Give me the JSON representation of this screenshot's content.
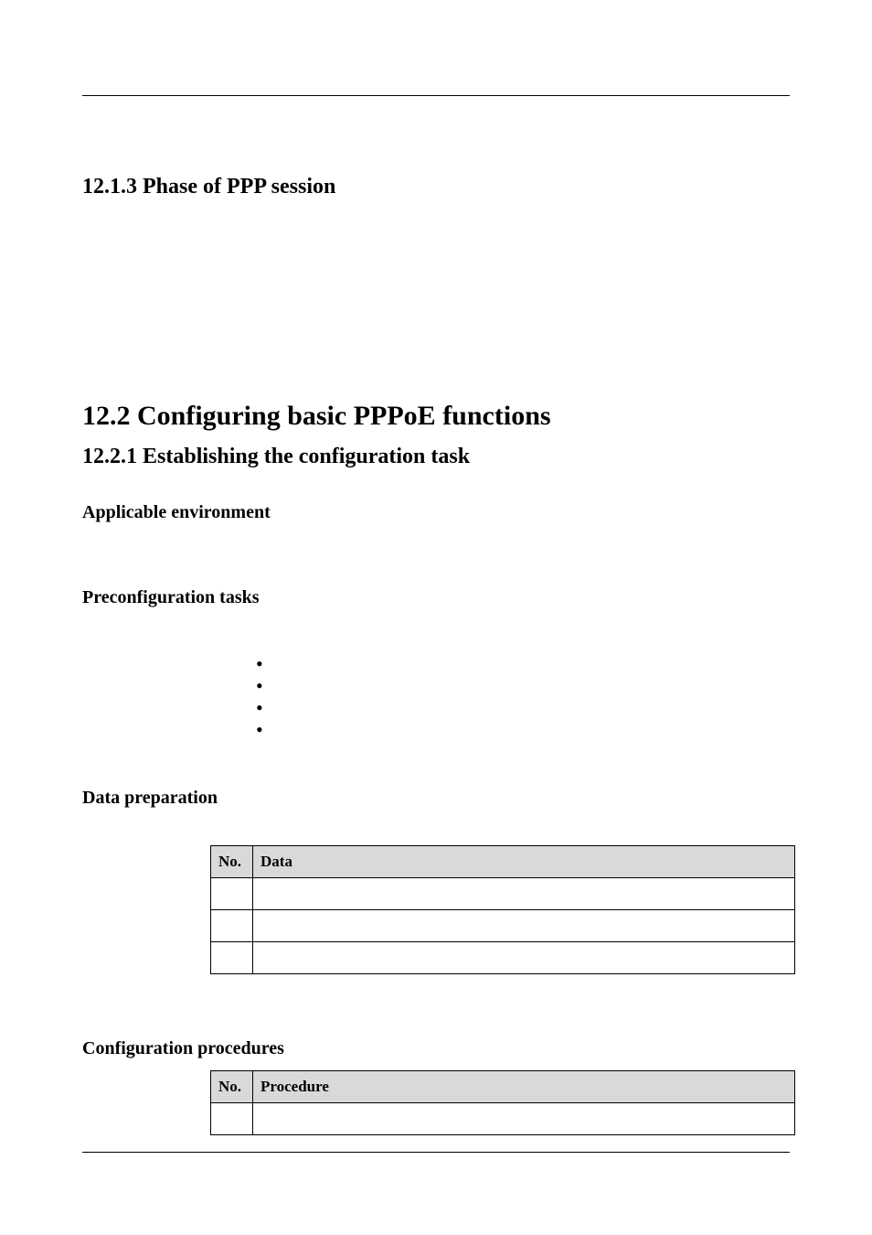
{
  "headings": {
    "sec_12_1_3": "12.1.3 Phase of PPP session",
    "sec_12_2": "12.2 Configuring basic PPPoE functions",
    "sec_12_2_1": "12.2.1 Establishing the configuration task",
    "applicable_env": "Applicable environment",
    "preconfig": "Preconfiguration tasks",
    "data_prep": "Data preparation",
    "config_proc": "Configuration procedures"
  },
  "bullets": [
    "",
    "",
    "",
    ""
  ],
  "data_table": {
    "headers": {
      "no": "No.",
      "data": "Data"
    },
    "rows": [
      {
        "no": "",
        "data": ""
      },
      {
        "no": "",
        "data": ""
      },
      {
        "no": "",
        "data": ""
      }
    ]
  },
  "proc_table": {
    "headers": {
      "no": "No.",
      "procedure": "Procedure"
    },
    "rows": [
      {
        "no": "",
        "procedure": ""
      }
    ]
  }
}
